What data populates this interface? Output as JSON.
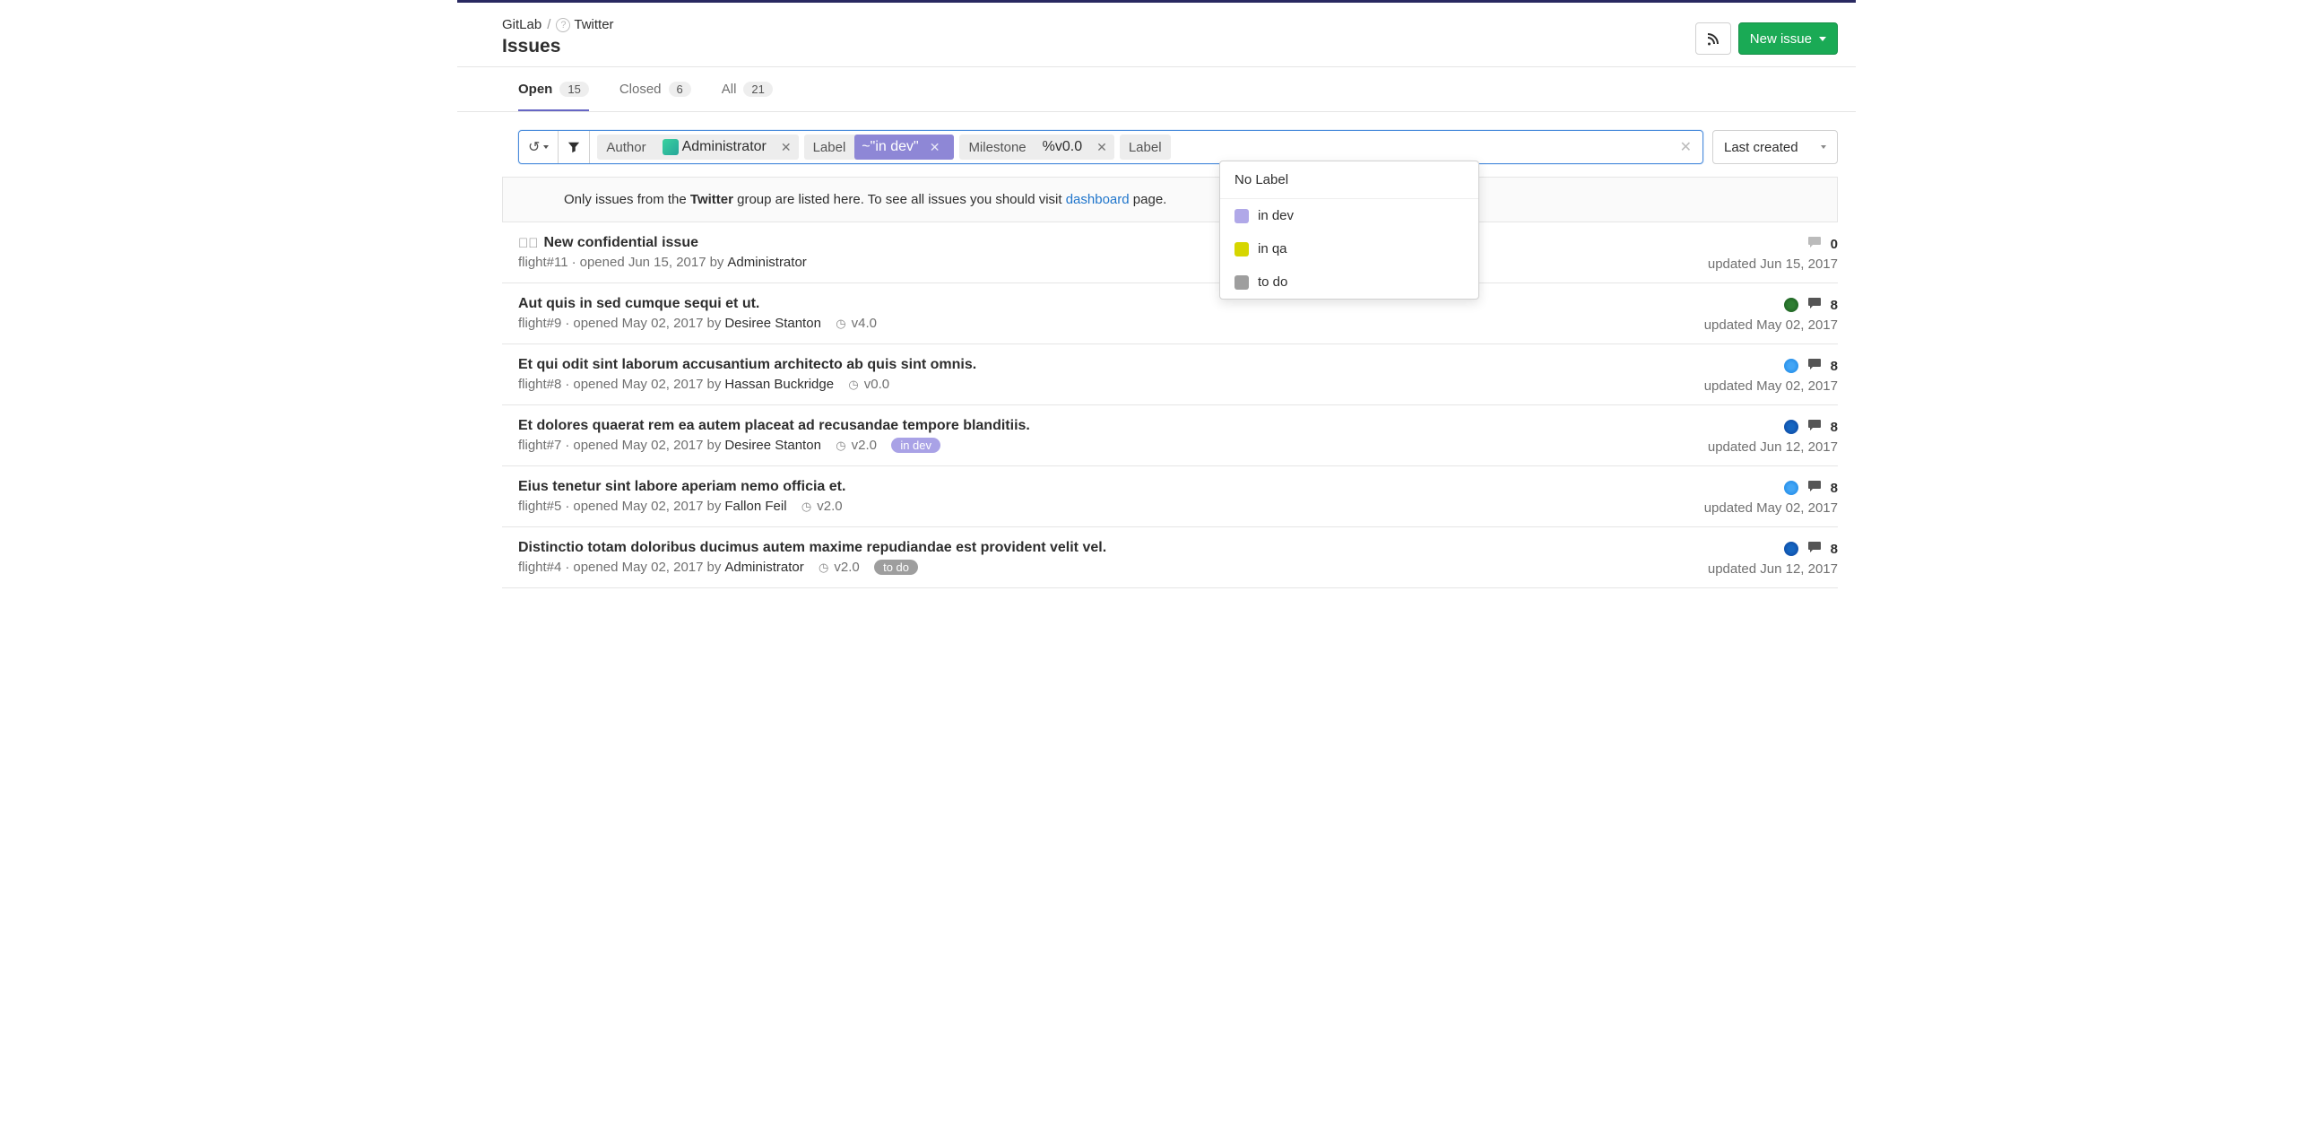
{
  "breadcrumbs": {
    "root": "GitLab",
    "group": "Twitter"
  },
  "page_title": "Issues",
  "actions": {
    "new_issue": "New issue"
  },
  "tabs": {
    "open": {
      "label": "Open",
      "count": "15"
    },
    "closed": {
      "label": "Closed",
      "count": "6"
    },
    "all": {
      "label": "All",
      "count": "21"
    }
  },
  "filter": {
    "author_key": "Author",
    "author_val": "Administrator",
    "label_key": "Label",
    "label_val": "~\"in dev\"",
    "milestone_key": "Milestone",
    "milestone_val": "%v0.0",
    "trailing_label_key": "Label",
    "sort": "Last created"
  },
  "dropdown": {
    "header": "No Label",
    "items": [
      {
        "color": "purple",
        "label": "in dev"
      },
      {
        "color": "yellow",
        "label": "in qa"
      },
      {
        "color": "gray",
        "label": "to do"
      }
    ]
  },
  "notice": {
    "pre": "Only issues from the ",
    "group": "Twitter",
    "mid": " group are listed here. To see all issues you should visit ",
    "link": "dashboard",
    "post": " page."
  },
  "issues": [
    {
      "title": "New confidential issue",
      "confidential": true,
      "ref": "flight#11",
      "opened": "opened Jun 15, 2017",
      "by_label": "by",
      "author": "Administrator",
      "milestone": null,
      "pill": null,
      "assignee": null,
      "comments": "0",
      "comments_muted": true,
      "updated": "updated Jun 15, 2017"
    },
    {
      "title": "Aut quis in sed cumque sequi et ut.",
      "confidential": false,
      "ref": "flight#9",
      "opened": "opened May 02, 2017",
      "by_label": "by",
      "author": "Desiree Stanton",
      "milestone": "v4.0",
      "pill": null,
      "assignee": "a-green",
      "comments": "8",
      "comments_muted": false,
      "updated": "updated May 02, 2017"
    },
    {
      "title": "Et qui odit sint laborum accusantium architecto ab quis sint omnis.",
      "confidential": false,
      "ref": "flight#8",
      "opened": "opened May 02, 2017",
      "by_label": "by",
      "author": "Hassan Buckridge",
      "milestone": "v0.0",
      "pill": null,
      "assignee": "a-blue",
      "comments": "8",
      "comments_muted": false,
      "updated": "updated May 02, 2017"
    },
    {
      "title": "Et dolores quaerat rem ea autem placeat ad recusandae tempore blanditiis.",
      "confidential": false,
      "ref": "flight#7",
      "opened": "opened May 02, 2017",
      "by_label": "by",
      "author": "Desiree Stanton",
      "milestone": "v2.0",
      "pill": {
        "class": "indev",
        "text": "in dev"
      },
      "assignee": "a-dblue",
      "comments": "8",
      "comments_muted": false,
      "updated": "updated Jun 12, 2017"
    },
    {
      "title": "Eius tenetur sint labore aperiam nemo officia et.",
      "confidential": false,
      "ref": "flight#5",
      "opened": "opened May 02, 2017",
      "by_label": "by",
      "author": "Fallon Feil",
      "milestone": "v2.0",
      "pill": null,
      "assignee": "a-blue",
      "comments": "8",
      "comments_muted": false,
      "updated": "updated May 02, 2017"
    },
    {
      "title": "Distinctio totam doloribus ducimus autem maxime repudiandae est provident velit vel.",
      "confidential": false,
      "ref": "flight#4",
      "opened": "opened May 02, 2017",
      "by_label": "by",
      "author": "Administrator",
      "milestone": "v2.0",
      "pill": {
        "class": "todo",
        "text": "to do"
      },
      "assignee": "a-dblue",
      "comments": "8",
      "comments_muted": false,
      "updated": "updated Jun 12, 2017"
    }
  ]
}
